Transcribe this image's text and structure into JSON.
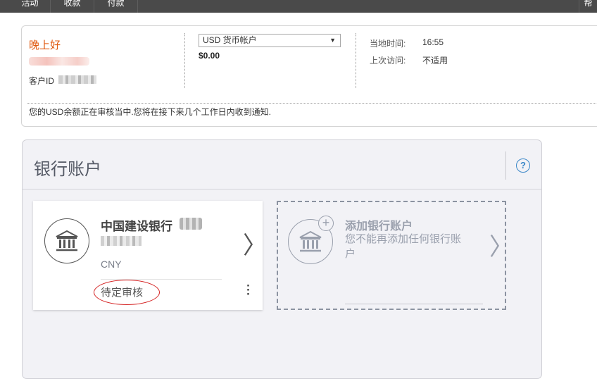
{
  "nav": {
    "tabs": [
      "活动",
      "收款",
      "付款",
      "帮"
    ]
  },
  "summary": {
    "greeting": "晚上好",
    "customer_id_label": "客户ID",
    "currency_account": "USD 货币帐户",
    "balance": "$0.00",
    "local_time_label": "当地时间:",
    "local_time_value": "16:55",
    "last_visit_label": "上次访问:",
    "last_visit_value": "不适用",
    "notice": "您的USD余额正在审核当中.您将在接下来几个工作日内收到通知."
  },
  "bank_accounts": {
    "title": "银行账户",
    "help_label": "?",
    "account_card": {
      "bank_name": "中国建设银行",
      "currency": "CNY",
      "status": "待定审核",
      "more_icon": "⋮"
    },
    "add_card": {
      "title": "添加银行账户",
      "subtitle": "您不能再添加任何银行账户"
    },
    "colors": {
      "greeting": "#e05a10",
      "help": "#3a87c8",
      "annotation": "#d42020"
    }
  }
}
